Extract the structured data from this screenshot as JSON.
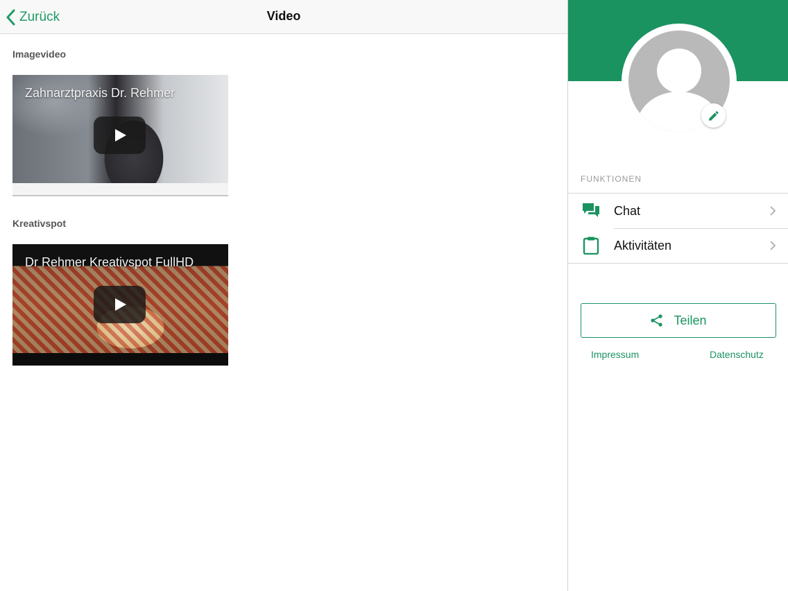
{
  "navbar": {
    "back_label": "Zurück",
    "title": "Video"
  },
  "sections": [
    {
      "title": "Imagevideo",
      "video_title": "Zahnarztpraxis Dr. Rehmer"
    },
    {
      "title": "Kreativspot",
      "video_title": "Dr Rehmer Kreativspot FullHD"
    }
  ],
  "sidebar": {
    "functions_label": "FUNKTIONEN",
    "items": [
      {
        "label": "Chat",
        "icon": "chat-icon"
      },
      {
        "label": "Aktivitäten",
        "icon": "clipboard-icon"
      }
    ],
    "share_label": "Teilen",
    "impressum_label": "Impressum",
    "datenschutz_label": "Datenschutz"
  },
  "colors": {
    "accent": "#1a9361",
    "header_bg": "#1a9361"
  }
}
